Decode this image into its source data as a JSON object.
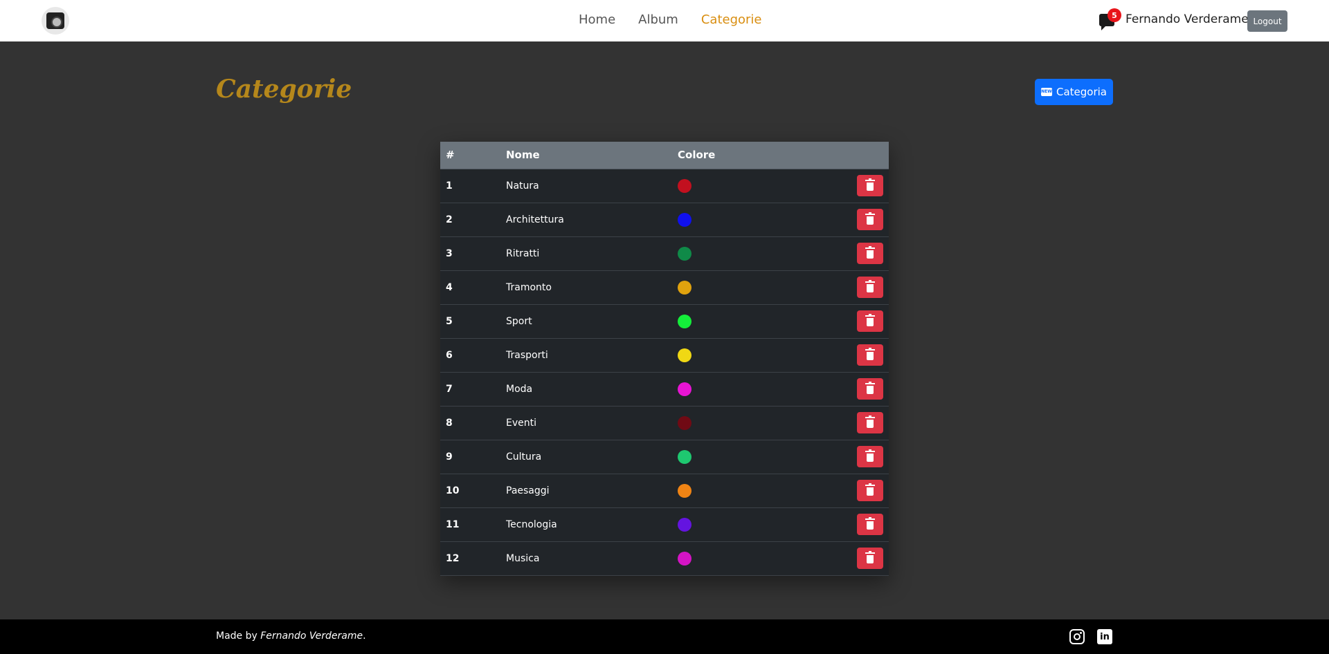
{
  "nav": {
    "links": [
      {
        "label": "Home",
        "active": false
      },
      {
        "label": "Album",
        "active": false
      },
      {
        "label": "Categorie",
        "active": true
      }
    ],
    "notifications_count": "5",
    "user_name": "Fernando Verderame",
    "logout_label": "Logout"
  },
  "page": {
    "title": "Categorie",
    "new_button_label": "Categoria",
    "new_icon_text": "NEW"
  },
  "table": {
    "headers": {
      "num": "#",
      "name": "Nome",
      "color": "Colore"
    },
    "rows": [
      {
        "num": "1",
        "name": "Natura",
        "color": "#c2101f"
      },
      {
        "num": "2",
        "name": "Architettura",
        "color": "#1010ee"
      },
      {
        "num": "3",
        "name": "Ritratti",
        "color": "#0f8a48"
      },
      {
        "num": "4",
        "name": "Tramonto",
        "color": "#e0a20e"
      },
      {
        "num": "5",
        "name": "Sport",
        "color": "#14ee3a"
      },
      {
        "num": "6",
        "name": "Trasporti",
        "color": "#f0d814"
      },
      {
        "num": "7",
        "name": "Moda",
        "color": "#e814d4"
      },
      {
        "num": "8",
        "name": "Eventi",
        "color": "#700a14"
      },
      {
        "num": "9",
        "name": "Cultura",
        "color": "#1ec870"
      },
      {
        "num": "10",
        "name": "Paesaggi",
        "color": "#f08414"
      },
      {
        "num": "11",
        "name": "Tecnologia",
        "color": "#6414e0"
      },
      {
        "num": "12",
        "name": "Musica",
        "color": "#d414c4"
      }
    ]
  },
  "footer": {
    "made_by": "Made by",
    "author": "Fernando Verderame",
    "period": ".",
    "linkedin_text": "in"
  }
}
